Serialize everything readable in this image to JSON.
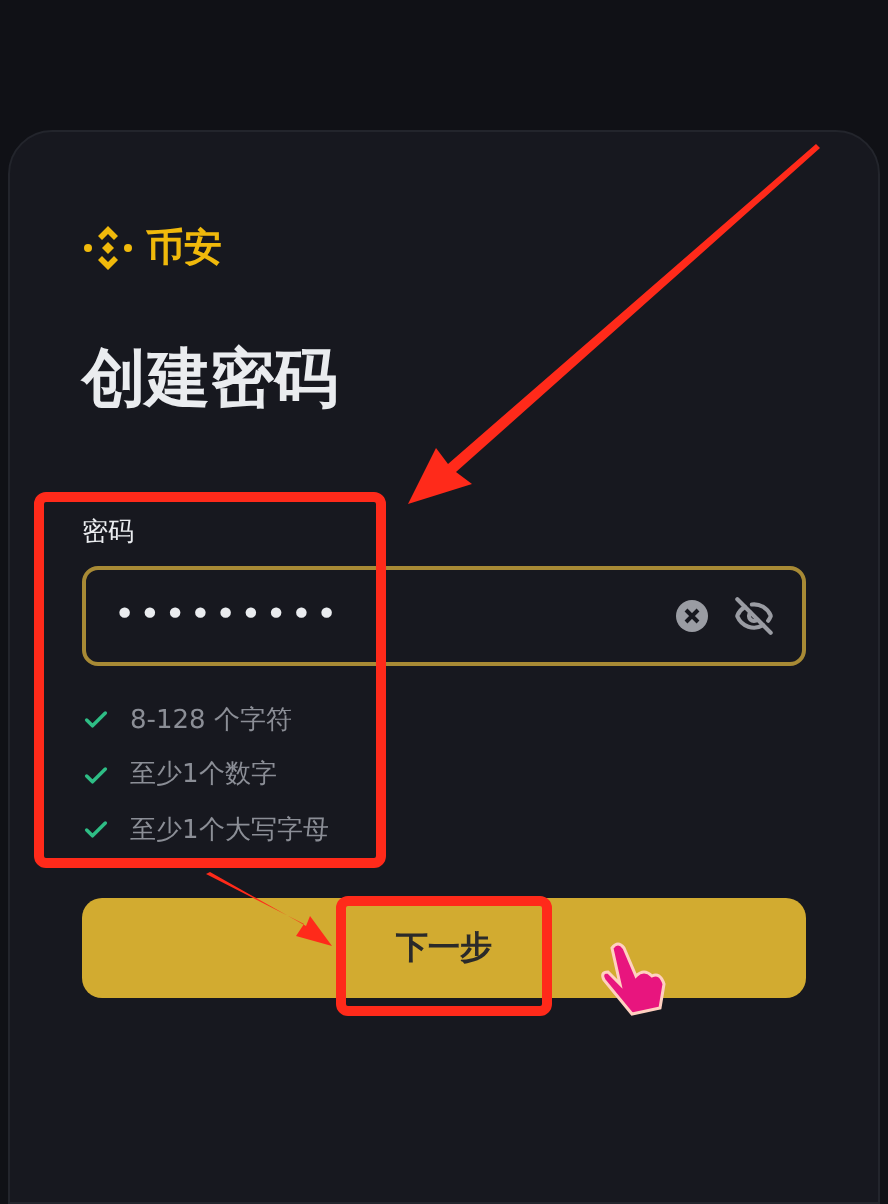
{
  "brand": {
    "name": "币安"
  },
  "title": "创建密码",
  "password_field": {
    "label": "密码",
    "value": "•••••••••",
    "focused": true
  },
  "requirements": [
    {
      "text": "8-128 个字符",
      "met": true
    },
    {
      "text": "至少1个数字",
      "met": true
    },
    {
      "text": "至少1个大写字母",
      "met": true
    }
  ],
  "next_button": {
    "label": "下一步"
  }
}
